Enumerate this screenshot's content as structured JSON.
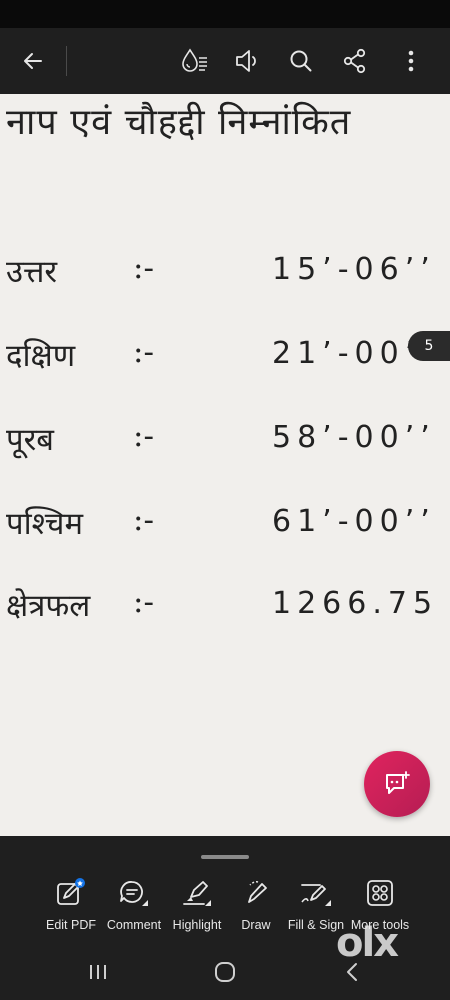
{
  "toolbar": {
    "icons": [
      "back-arrow-icon",
      "liquid-mode-icon",
      "read-aloud-icon",
      "search-icon",
      "share-icon",
      "more-options-icon"
    ]
  },
  "document": {
    "heading": "नाप एवं चौहद्दी निम्नांकित",
    "rows": [
      {
        "label": "उत्तर",
        "colon": ":-",
        "value": "15’-06’’"
      },
      {
        "label": "दक्षिण",
        "colon": ":-",
        "value": "21’-00’’"
      },
      {
        "label": "पूरब",
        "colon": ":-",
        "value": "58’-00’’"
      },
      {
        "label": "पश्चिम",
        "colon": ":-",
        "value": "61’-00’’"
      },
      {
        "label": "क्षेत्रफल",
        "colon": ":-",
        "value": "1266.75"
      }
    ],
    "page_number": "5"
  },
  "bottom_tools": [
    {
      "label": "Edit PDF",
      "icon": "edit-pdf-icon"
    },
    {
      "label": "Comment",
      "icon": "comment-icon"
    },
    {
      "label": "Highlight",
      "icon": "highlight-icon"
    },
    {
      "label": "Draw",
      "icon": "draw-icon"
    },
    {
      "label": "Fill & Sign",
      "icon": "fill-sign-icon"
    },
    {
      "label": "More tools",
      "icon": "more-tools-icon"
    }
  ],
  "watermark": "olx",
  "colors": {
    "toolbar_bg": "#1f1f1f",
    "page_bg": "#f1efec",
    "fab_accent": "#d9235b",
    "badge_blue": "#1473e6"
  }
}
